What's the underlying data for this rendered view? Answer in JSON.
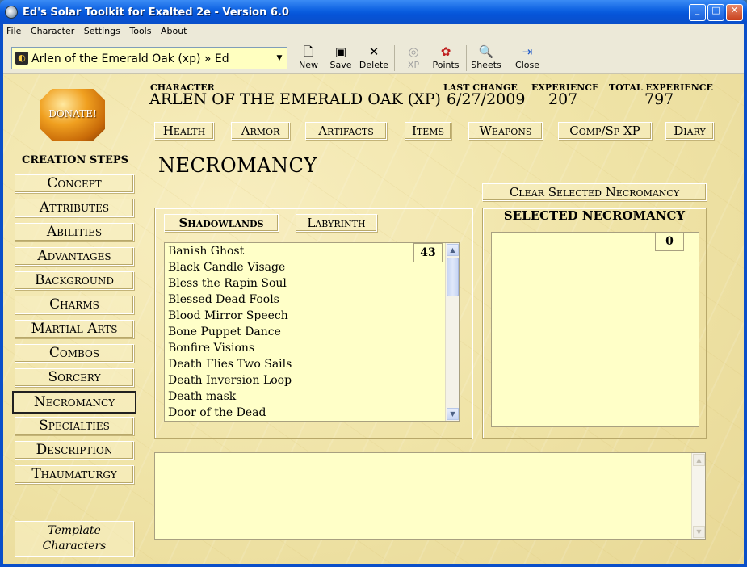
{
  "window": {
    "title": "Ed's Solar Toolkit for Exalted 2e - Version 6.0",
    "minimize": "_",
    "maximize": "□",
    "close": "✕"
  },
  "menu": [
    "File",
    "Character",
    "Settings",
    "Tools",
    "About"
  ],
  "toolbar": {
    "character_select": "Arlen of the Emerald Oak (xp) » Ed",
    "buttons": {
      "new": "New",
      "save": "Save",
      "delete": "Delete",
      "xp": "XP",
      "points": "Points",
      "sheets": "Sheets",
      "close": "Close"
    }
  },
  "donate": "DONATE!",
  "creation_steps": {
    "title": "CREATION STEPS",
    "items": [
      "Concept",
      "Attributes",
      "Abilities",
      "Advantages",
      "Background",
      "Charms",
      "Martial Arts",
      "Combos",
      "Sorcery",
      "Necromancy",
      "Specialties",
      "Description",
      "Thaumaturgy"
    ],
    "active": "Necromancy",
    "template_line1": "Template",
    "template_line2": "Characters"
  },
  "header": {
    "character_label": "CHARACTER",
    "character_name": "ARLEN OF THE EMERALD OAK (XP)",
    "last_change_label": "LAST CHANGE",
    "last_change": "6/27/2009",
    "experience_label": "EXPERIENCE",
    "experience": "207",
    "total_experience_label": "TOTAL EXPERIENCE",
    "total_experience": "797"
  },
  "section_tabs": [
    "Health",
    "Armor",
    "Artifacts",
    "Items",
    "Weapons",
    "Comp/Sp XP",
    "Diary"
  ],
  "page_title": "NECROMANCY",
  "clear_button": "Clear Selected Necromancy",
  "circle_tabs": [
    "Shadowlands",
    "Labyrinth"
  ],
  "active_circle": "Shadowlands",
  "available_count": "43",
  "spells": [
    "Banish Ghost",
    "Black Candle Visage",
    "Bless the Rapin Soul",
    "Blessed Dead Fools",
    "Blood Mirror Speech",
    "Bone Puppet Dance",
    "Bonfire Visions",
    "Death Flies Two Sails",
    "Death Inversion Loop",
    "Death mask",
    "Door of the Dead"
  ],
  "selected": {
    "title": "SELECTED NECROMANCY",
    "count": "0"
  },
  "colors": {
    "parchment": "#efe3a6",
    "field": "#ffffc8",
    "titlebar": "#0a5ee0"
  },
  "icons": {
    "new": "document-icon",
    "save": "floppy-icon",
    "delete": "x-icon",
    "xp": "xp-orb-icon",
    "points": "points-icon",
    "sheets": "sheets-icon",
    "close": "exit-door-icon"
  }
}
